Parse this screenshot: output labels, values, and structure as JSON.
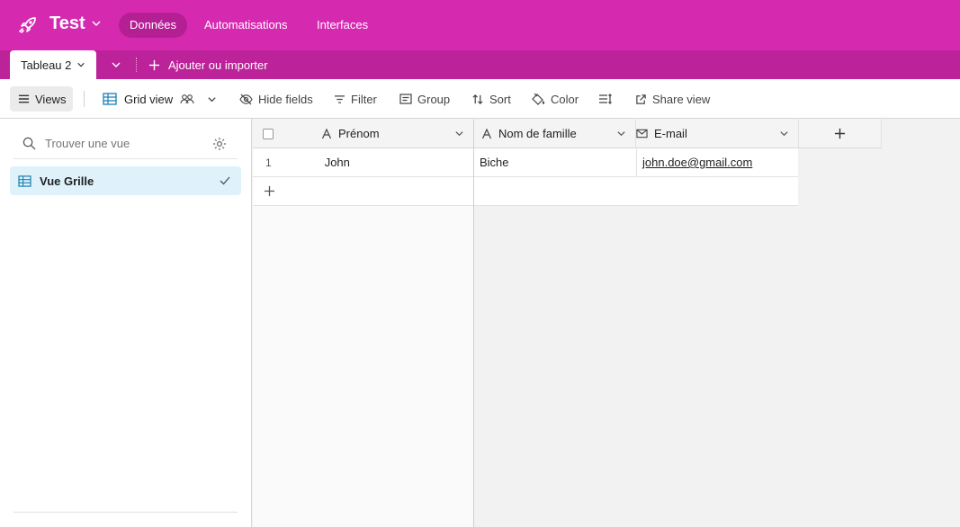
{
  "header": {
    "base_name": "Test",
    "nav": [
      {
        "label": "Données",
        "active": true
      },
      {
        "label": "Automatisations",
        "active": false
      },
      {
        "label": "Interfaces",
        "active": false
      }
    ],
    "brand_color": "#d52ab0"
  },
  "tables": {
    "active_tab": "Tableau 2",
    "add_label": "Ajouter ou importer"
  },
  "toolbar": {
    "views_label": "Views",
    "grid_view_label": "Grid view",
    "hide_fields_label": "Hide fields",
    "filter_label": "Filter",
    "group_label": "Group",
    "sort_label": "Sort",
    "color_label": "Color",
    "share_label": "Share view"
  },
  "sidebar": {
    "search_placeholder": "Trouver une vue",
    "views": [
      {
        "label": "Vue Grille",
        "selected": true,
        "icon": "grid-icon"
      }
    ]
  },
  "grid": {
    "columns": [
      {
        "label": "Prénom",
        "icon": "text-field-icon"
      },
      {
        "label": "Nom de famille",
        "icon": "text-field-icon"
      },
      {
        "label": "E-mail",
        "icon": "email-field-icon"
      }
    ],
    "rows": [
      {
        "index": "1",
        "prenom": "John",
        "nom": "Biche",
        "email": "john.doe@gmail.com"
      }
    ]
  }
}
